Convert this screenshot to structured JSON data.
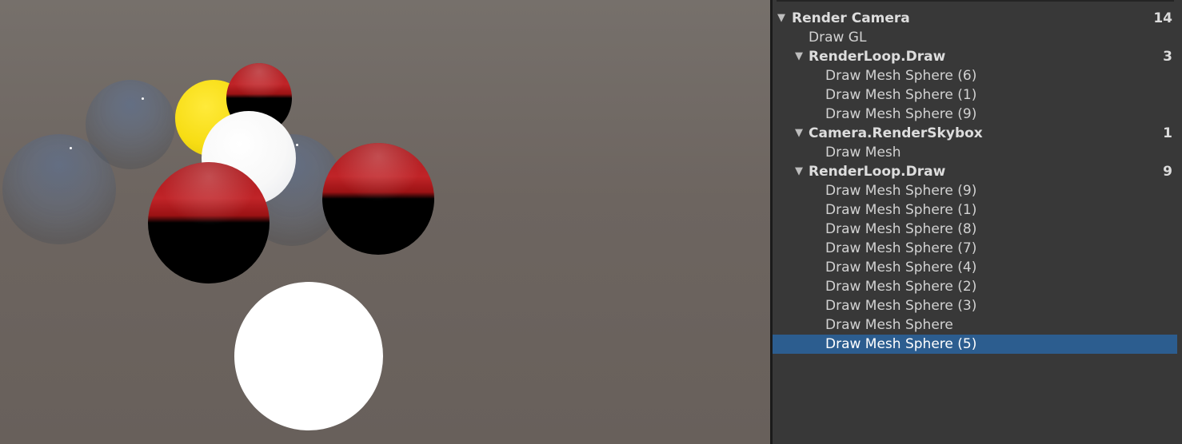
{
  "colors": {
    "panel_bg": "#383838",
    "selection": "#2c5d8f",
    "scene_bg": "#6d6560",
    "sphere_red": "#c02428",
    "sphere_yellow": "#f7dd14"
  },
  "scene": {
    "objects": [
      "glass-sphere",
      "glass-sphere",
      "glass-sphere",
      "yellow-sphere",
      "white-sphere",
      "red-black-sphere",
      "red-black-sphere",
      "red-black-sphere",
      "white-sphere"
    ]
  },
  "frame_debugger": {
    "root": {
      "label": "Render Camera",
      "count": "14",
      "arrow": "▼"
    },
    "draw_gl": {
      "label": "Draw GL"
    },
    "group1": {
      "label": "RenderLoop.Draw",
      "count": "3",
      "arrow": "▼",
      "items": [
        "Draw Mesh Sphere (6)",
        "Draw Mesh Sphere (1)",
        "Draw Mesh Sphere (9)"
      ]
    },
    "group2": {
      "label": "Camera.RenderSkybox",
      "count": "1",
      "arrow": "▼",
      "items": [
        "Draw Mesh"
      ]
    },
    "group3": {
      "label": "RenderLoop.Draw",
      "count": "9",
      "arrow": "▼",
      "items": [
        "Draw Mesh Sphere (9)",
        "Draw Mesh Sphere (1)",
        "Draw Mesh Sphere (8)",
        "Draw Mesh Sphere (7)",
        "Draw Mesh Sphere (4)",
        "Draw Mesh Sphere (2)",
        "Draw Mesh Sphere (3)",
        "Draw Mesh Sphere",
        "Draw Mesh Sphere (5)"
      ]
    },
    "selected_item": "Draw Mesh Sphere (5)"
  }
}
